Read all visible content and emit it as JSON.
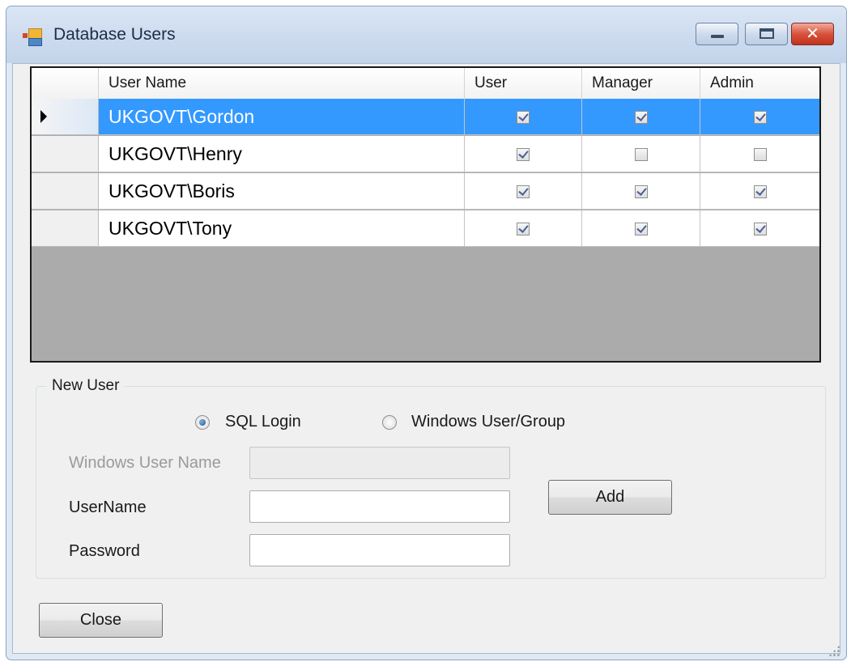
{
  "window": {
    "title": "Database Users",
    "icon": "app-window-icon",
    "controls": [
      "minimize-icon",
      "maximize-icon",
      "close-icon"
    ]
  },
  "grid": {
    "columns": [
      "User Name",
      "User",
      "Manager",
      "Admin"
    ],
    "rows": [
      {
        "name": "UKGOVT\\Gordon",
        "user": true,
        "manager": true,
        "admin": true,
        "selected": true
      },
      {
        "name": "UKGOVT\\Henry",
        "user": true,
        "manager": false,
        "admin": false,
        "selected": false
      },
      {
        "name": "UKGOVT\\Boris",
        "user": true,
        "manager": true,
        "admin": true,
        "selected": false
      },
      {
        "name": "UKGOVT\\Tony",
        "user": true,
        "manager": true,
        "admin": true,
        "selected": false
      }
    ]
  },
  "new_user": {
    "group_title": "New User",
    "auth_options": [
      {
        "label": "SQL Login",
        "checked": true
      },
      {
        "label": "Windows User/Group",
        "checked": false
      }
    ],
    "windows_user_name_label": "Windows User Name",
    "windows_user_name_value": "",
    "username_label": "UserName",
    "username_value": "",
    "password_label": "Password",
    "password_value": "",
    "add_label": "Add"
  },
  "close_label": "Close",
  "colors": {
    "selection": "#3399ff",
    "grid_background": "#ababab"
  }
}
